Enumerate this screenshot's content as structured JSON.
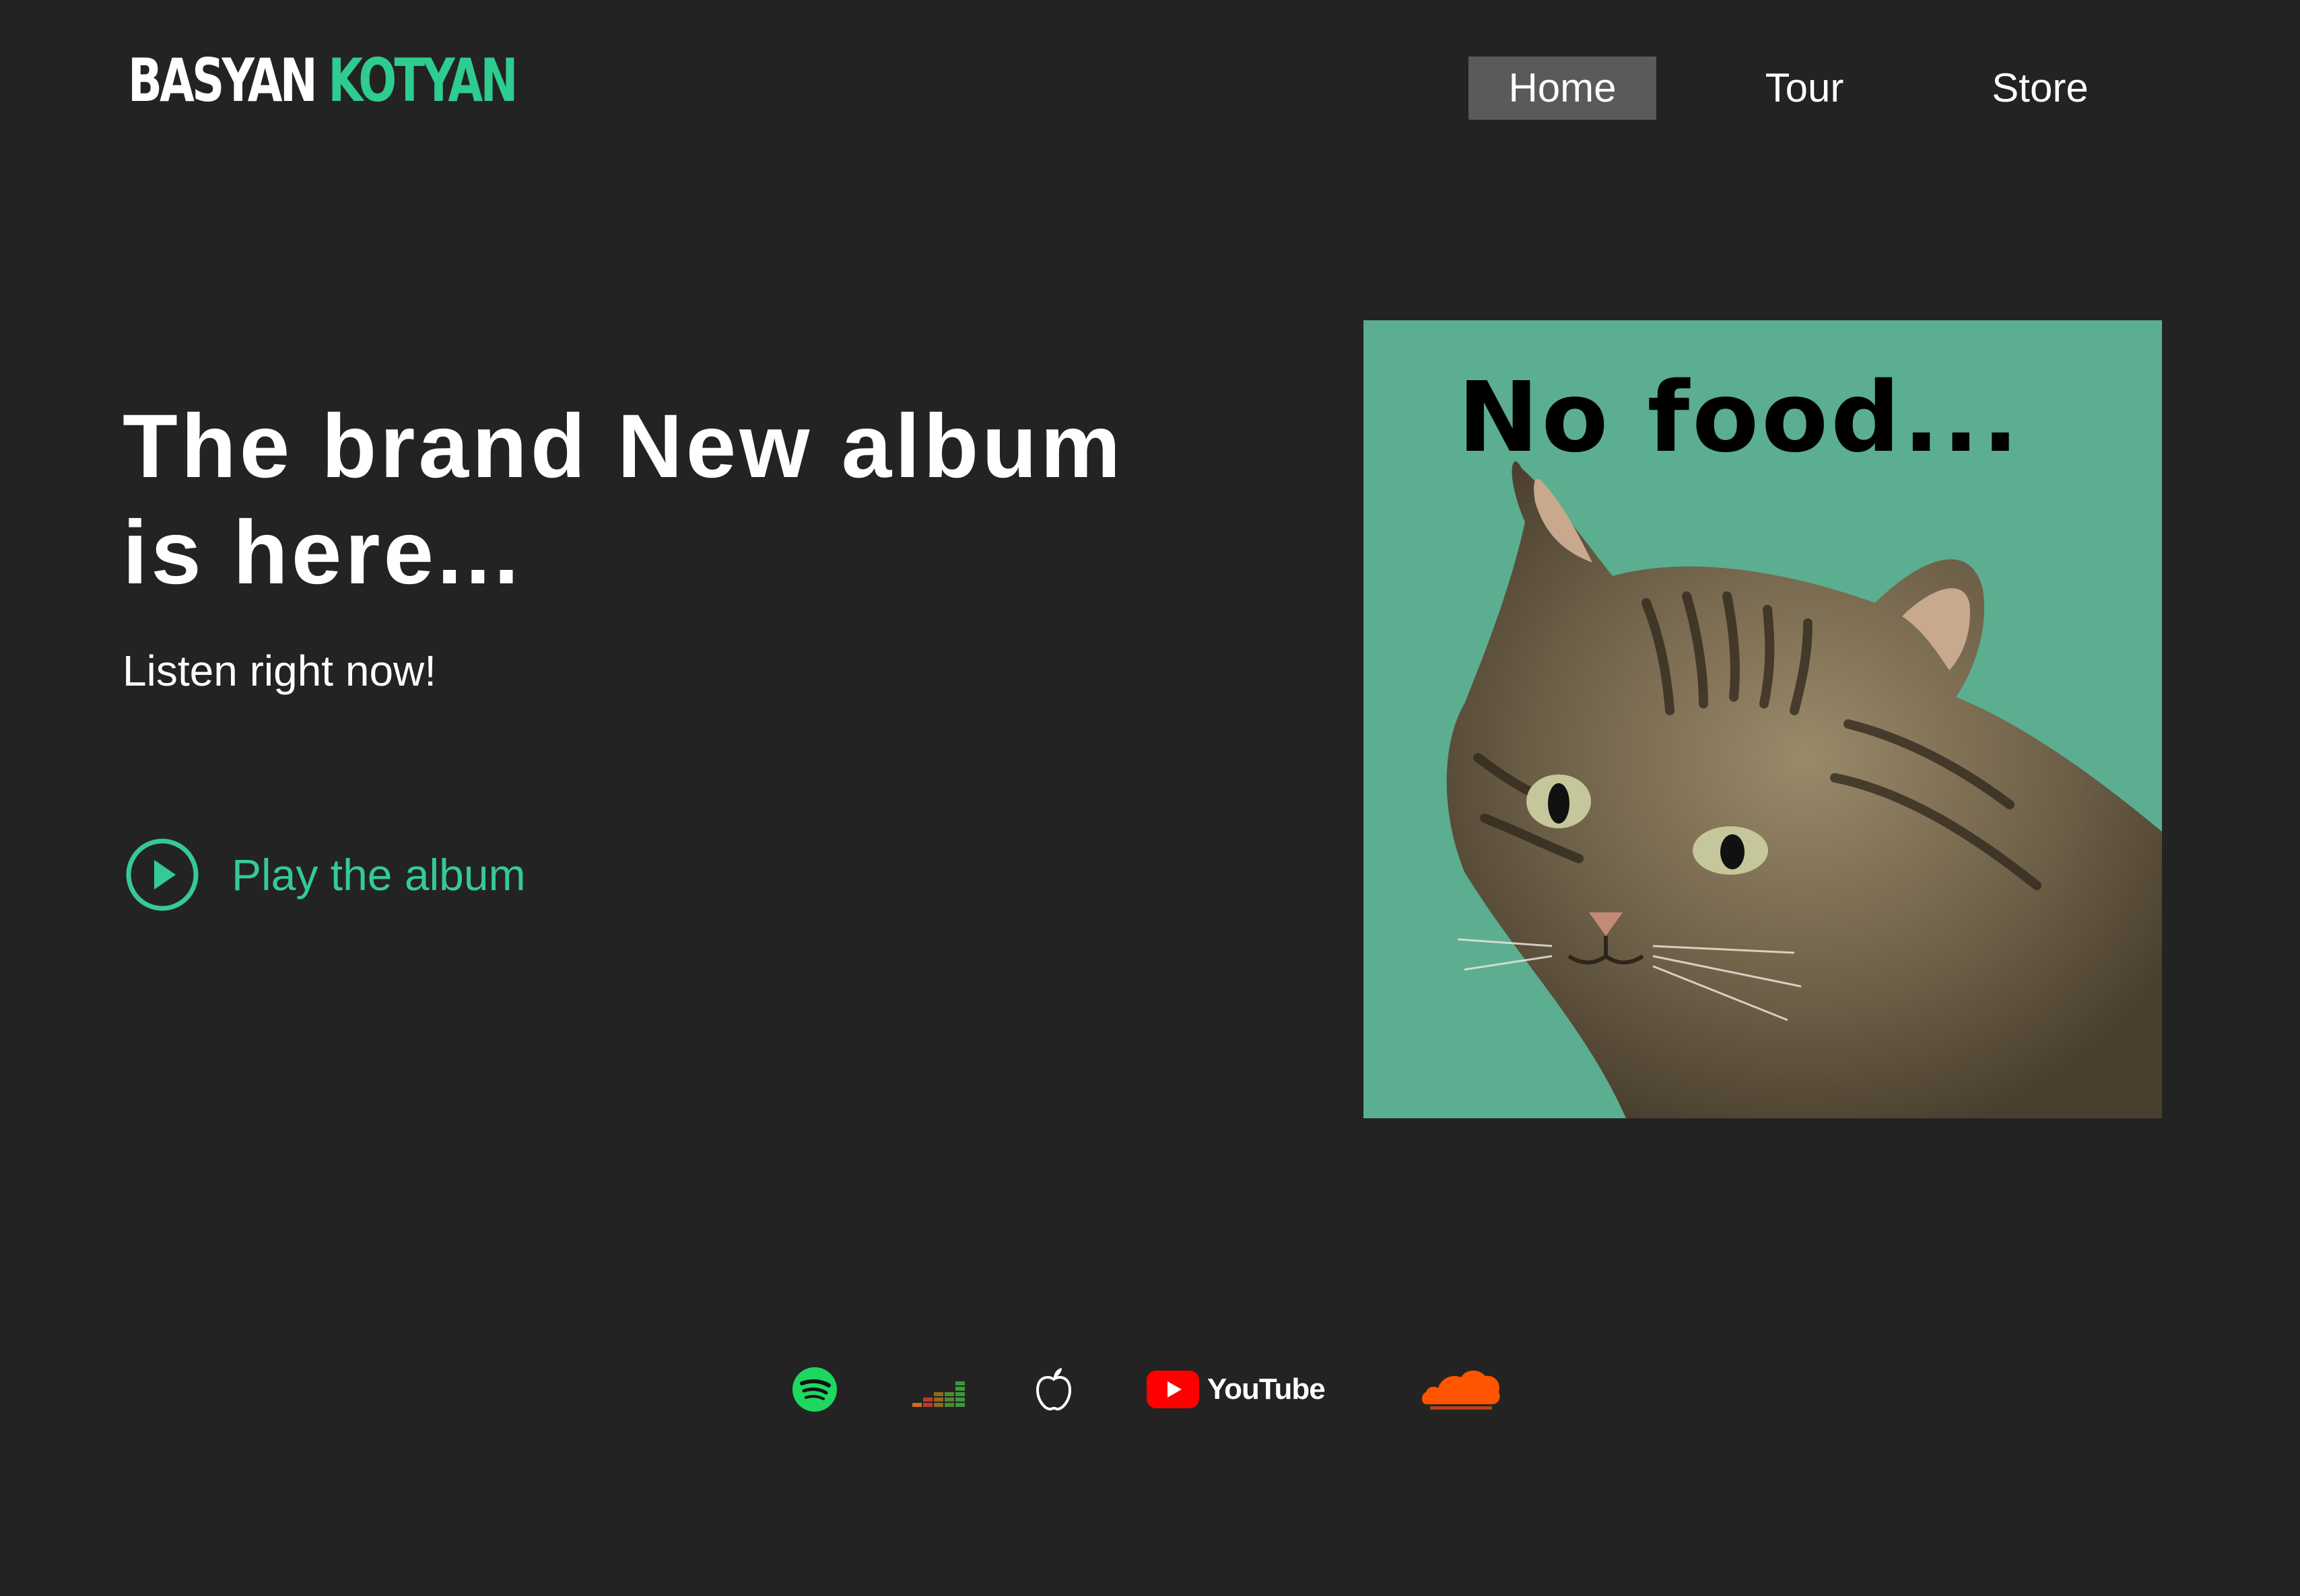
{
  "brand": {
    "first": "BASYAN",
    "second": "KOTYAN",
    "accent": "#2ecc8f"
  },
  "nav": {
    "items": [
      {
        "label": "Home",
        "active": true
      },
      {
        "label": "Tour",
        "active": false
      },
      {
        "label": "Store",
        "active": false
      }
    ]
  },
  "hero": {
    "title_line1": "The brand New album",
    "title_line2": "is here...",
    "subtitle": "Listen right now!",
    "play_label": "Play the album"
  },
  "album_cover": {
    "caption": "No food...",
    "background": "#5bae90",
    "image": "tabby-cat-photo"
  },
  "services": {
    "items": [
      {
        "name": "Spotify",
        "icon": "spotify-icon",
        "color": "#1ed760"
      },
      {
        "name": "Deezer",
        "icon": "deezer-icon",
        "color": "#a0501e"
      },
      {
        "name": "Apple Music",
        "icon": "apple-icon",
        "color": "#ffffff"
      },
      {
        "name": "YouTube",
        "icon": "youtube-icon",
        "label": "YouTube",
        "color": "#ff0000"
      },
      {
        "name": "SoundCloud",
        "icon": "soundcloud-icon",
        "color": "#ff5500"
      }
    ]
  }
}
